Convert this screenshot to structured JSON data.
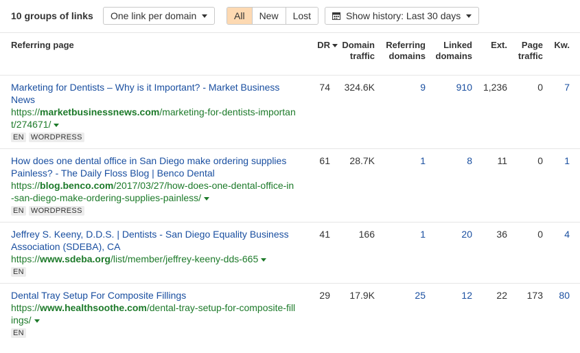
{
  "toolbar": {
    "groups_label": "10 groups of links",
    "link_mode": "One link per domain",
    "filters": [
      "All",
      "New",
      "Lost"
    ],
    "active_filter": "All",
    "history_label": "Show history: Last 30 days"
  },
  "table": {
    "headers": {
      "referring_page": "Referring page",
      "dr": "DR",
      "domain_traffic_1": "Domain",
      "domain_traffic_2": "traffic",
      "ref_domains_1": "Referring",
      "ref_domains_2": "domains",
      "linked_domains_1": "Linked",
      "linked_domains_2": "domains",
      "ext": "Ext.",
      "page_traffic_1": "Page",
      "page_traffic_2": "traffic",
      "kw": "Kw."
    },
    "rows": [
      {
        "title_1": "Marketing for Dentists – Why is it Important? - Market Business",
        "title_2": "News",
        "url_prefix": "https://",
        "url_domain": "marketbusinessnews.com",
        "url_path_1": "/marketing-for-dentists-importan",
        "url_path_2": "t/274671/",
        "tags": [
          "EN",
          "WORDPRESS"
        ],
        "dr": "74",
        "domain_traffic": "324.6K",
        "ref_domains": "9",
        "linked_domains": "910",
        "ext": "1,236",
        "page_traffic": "0",
        "kw": "7"
      },
      {
        "title_1": "How does one dental office in San Diego make ordering supplies",
        "title_2": "Painless? - The Daily Floss Blog | Benco Dental",
        "url_prefix": "https://",
        "url_domain": "blog.benco.com",
        "url_path_1": "/2017/03/27/how-does-one-dental-office-in",
        "url_path_2": "-san-diego-make-ordering-supplies-painless/",
        "tags": [
          "EN",
          "WORDPRESS"
        ],
        "dr": "61",
        "domain_traffic": "28.7K",
        "ref_domains": "1",
        "linked_domains": "8",
        "ext": "11",
        "page_traffic": "0",
        "kw": "1"
      },
      {
        "title_1": "Jeffrey S. Keeny, D.D.S. | Dentists - San Diego Equality Business",
        "title_2": "Association (SDEBA), CA",
        "url_prefix": "https://",
        "url_domain": "www.sdeba.org",
        "url_path_1": "/list/member/jeffrey-keeny-dds-665",
        "url_path_2": "",
        "tags": [
          "EN"
        ],
        "dr": "41",
        "domain_traffic": "166",
        "ref_domains": "1",
        "linked_domains": "20",
        "ext": "36",
        "page_traffic": "0",
        "kw": "4"
      },
      {
        "title_1": "Dental Tray Setup For Composite Fillings",
        "title_2": "",
        "url_prefix": "https://",
        "url_domain": "www.healthsoothe.com",
        "url_path_1": "/dental-tray-setup-for-composite-fill",
        "url_path_2": "ings/",
        "tags": [
          "EN"
        ],
        "dr": "29",
        "domain_traffic": "17.9K",
        "ref_domains": "25",
        "linked_domains": "12",
        "ext": "22",
        "page_traffic": "173",
        "kw": "80"
      }
    ]
  }
}
